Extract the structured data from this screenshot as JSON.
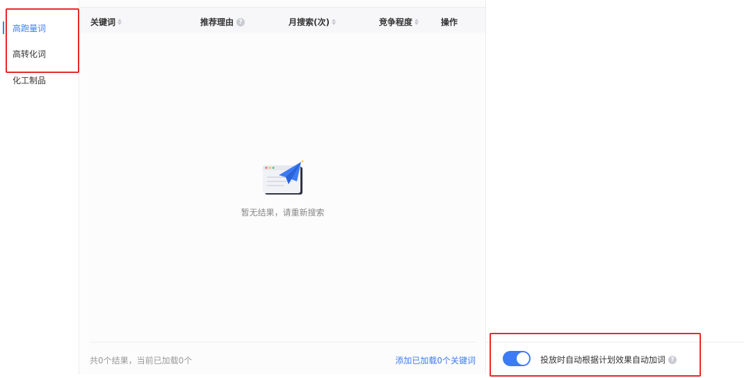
{
  "sidebar": {
    "items": [
      {
        "label": "高跑量词",
        "active": true
      },
      {
        "label": "高转化词",
        "active": false
      },
      {
        "label": "化工制品",
        "active": false
      }
    ]
  },
  "table": {
    "columns": [
      {
        "label": "关键词",
        "sortable": true
      },
      {
        "label": "推荐理由",
        "help": true
      },
      {
        "label": "月搜索(次)",
        "sortable": true
      },
      {
        "label": "竞争程度",
        "sortable": true
      },
      {
        "label": "操作"
      }
    ],
    "rows": []
  },
  "empty_state": {
    "icon": "paper-plane-illustration",
    "text": "暂无结果，请重新搜索"
  },
  "footer": {
    "summary": "共0个结果，当前已加载0个",
    "add_link": "添加已加载0个关键词"
  },
  "auto_add": {
    "enabled": true,
    "label": "投放时自动根据计划效果自动加词"
  },
  "colors": {
    "accent": "#3d7bf5",
    "highlight": "#e8262a"
  }
}
